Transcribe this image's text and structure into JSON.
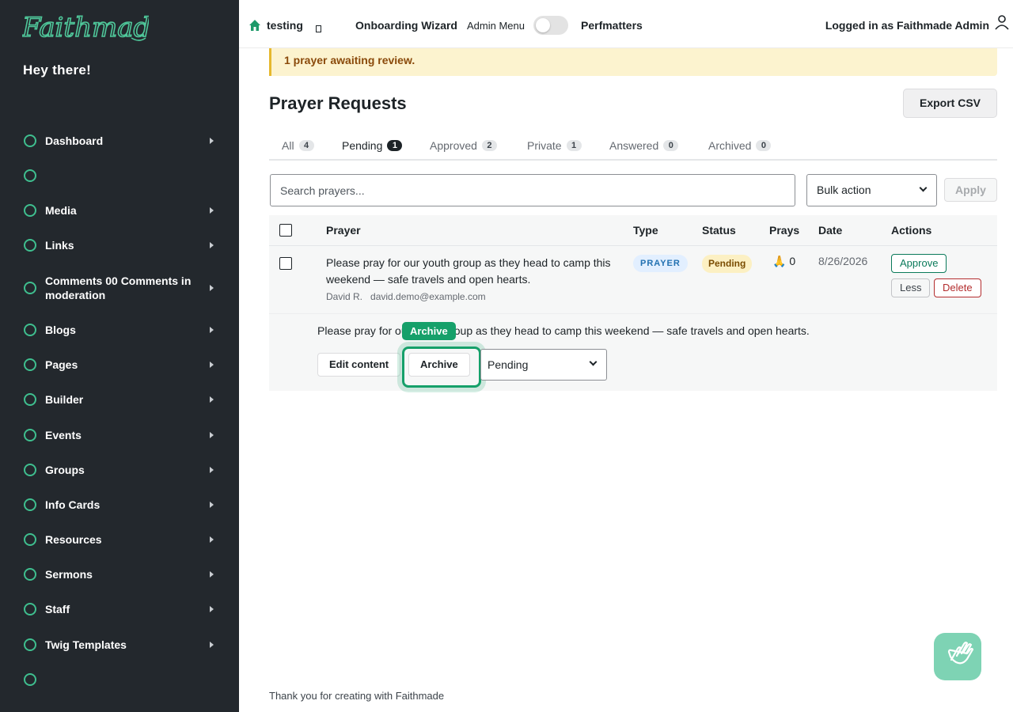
{
  "sidebar": {
    "logo_text": "Faithmade",
    "greeting": "Hey there!",
    "items": [
      {
        "label": "Dashboard",
        "arrow": true
      },
      {
        "label": "",
        "arrow": false
      },
      {
        "label": "Media",
        "arrow": true
      },
      {
        "label": "Links",
        "arrow": true
      },
      {
        "label": "Comments 00 Comments in moderation",
        "arrow": true
      },
      {
        "label": "Blogs",
        "arrow": true
      },
      {
        "label": "Pages",
        "arrow": true
      },
      {
        "label": "Builder",
        "arrow": true
      },
      {
        "label": "Events",
        "arrow": true
      },
      {
        "label": "Groups",
        "arrow": true
      },
      {
        "label": "Info Cards",
        "arrow": true
      },
      {
        "label": "Resources",
        "arrow": true
      },
      {
        "label": "Sermons",
        "arrow": true
      },
      {
        "label": "Staff",
        "arrow": true
      },
      {
        "label": "Twig Templates",
        "arrow": true
      },
      {
        "label": "",
        "arrow": false
      }
    ]
  },
  "topbar": {
    "site_name": "testing",
    "onboarding": "Onboarding Wizard",
    "admin_menu": "Admin Menu",
    "perfmatters": "Perfmatters",
    "logged_in": "Logged in as Faithmade Admin"
  },
  "notice": {
    "text": "1 prayer awaiting review."
  },
  "page": {
    "title": "Prayer Requests",
    "export_label": "Export CSV"
  },
  "tabs": [
    {
      "label": "All",
      "count": "4"
    },
    {
      "label": "Pending",
      "count": "1"
    },
    {
      "label": "Approved",
      "count": "2"
    },
    {
      "label": "Private",
      "count": "1"
    },
    {
      "label": "Answered",
      "count": "0"
    },
    {
      "label": "Archived",
      "count": "0"
    }
  ],
  "controls": {
    "search_placeholder": "Search prayers...",
    "bulk_action": "Bulk action",
    "apply": "Apply"
  },
  "table": {
    "headers": {
      "prayer": "Prayer",
      "type": "Type",
      "status": "Status",
      "prays": "Prays",
      "date": "Date",
      "actions": "Actions"
    },
    "row": {
      "text": "Please pray for our youth group as they head to camp this weekend — safe travels and open hearts.",
      "author": "David R.",
      "email": "david.demo@example.com",
      "type": "PRAYER",
      "status": "Pending",
      "prays_icon": "🙏",
      "prays": "0",
      "date": "8/26/2026",
      "approve": "Approve",
      "less": "Less",
      "delete": "Delete"
    },
    "detail": {
      "text": "Please pray for our youth group as they head to camp this weekend — safe travels and open hearts.",
      "edit": "Edit content",
      "archive": "Archive",
      "tooltip": "Archive",
      "status_value": "Pending"
    }
  },
  "footer": {
    "text": "Thank you for creating with Faithmade"
  },
  "colors": {
    "sidebar": "#23282d",
    "accent": "#16a06a",
    "notice": "#fcf3cf"
  }
}
